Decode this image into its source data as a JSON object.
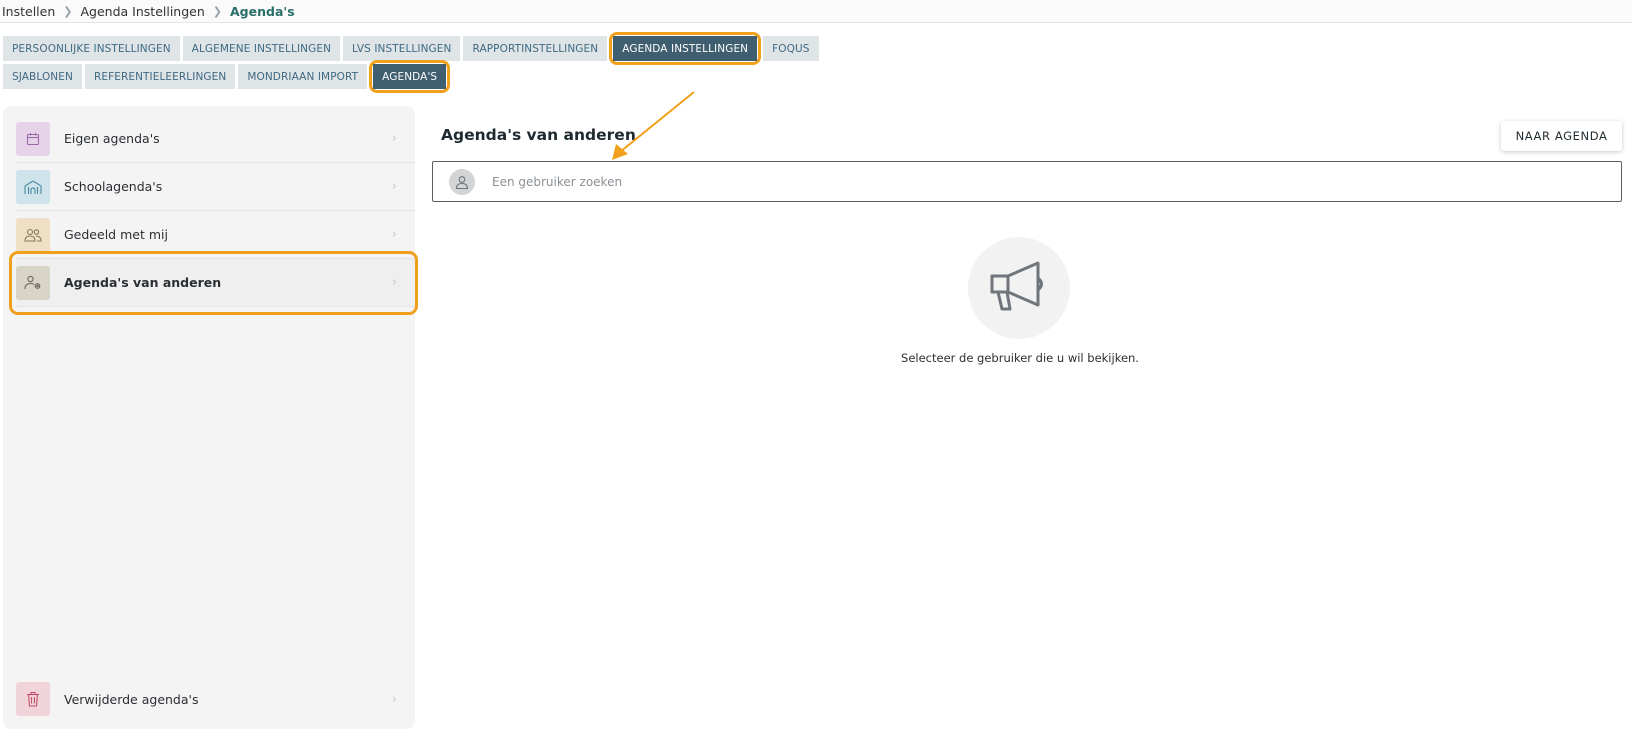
{
  "breadcrumb": {
    "items": [
      "Instellen",
      "Agenda Instellingen"
    ],
    "current": "Agenda's"
  },
  "tabs": {
    "row1": [
      "PERSOONLIJKE INSTELLINGEN",
      "ALGEMENE INSTELLINGEN",
      "LVS INSTELLINGEN",
      "RAPPORTINSTELLINGEN",
      "AGENDA INSTELLINGEN",
      "FOQUS"
    ],
    "row2": [
      "SJABLONEN",
      "REFERENTIELEERLINGEN",
      "MONDRIAAN IMPORT",
      "AGENDA'S"
    ],
    "active_row1": "AGENDA INSTELLINGEN",
    "active_row2": "AGENDA'S"
  },
  "sidebar": {
    "items": [
      {
        "label": "Eigen agenda's",
        "icon": "calendar-icon",
        "color": "#e6d3ea"
      },
      {
        "label": "Schoolagenda's",
        "icon": "school-icon",
        "color": "#cfe3ea"
      },
      {
        "label": "Gedeeld met mij",
        "icon": "users-icon",
        "color": "#efdfc4"
      },
      {
        "label": "Agenda's van anderen",
        "icon": "user-settings-icon",
        "color": "#d8d4c8"
      }
    ],
    "bottom_item": {
      "label": "Verwijderde agenda's",
      "icon": "trash-icon",
      "color": "#f1d3da"
    }
  },
  "main": {
    "title": "Agenda's van anderen",
    "naar_agenda_label": "NAAR AGENDA",
    "search_placeholder": "Een gebruiker zoeken",
    "empty_text": "Selecteer de gebruiker die u wil bekijken."
  },
  "colors": {
    "accent": "#f0a01c",
    "tab_active": "#3f5f70",
    "tab_inactive": "#dfe4e7",
    "breadcrumb_current": "#2a6f6a"
  }
}
